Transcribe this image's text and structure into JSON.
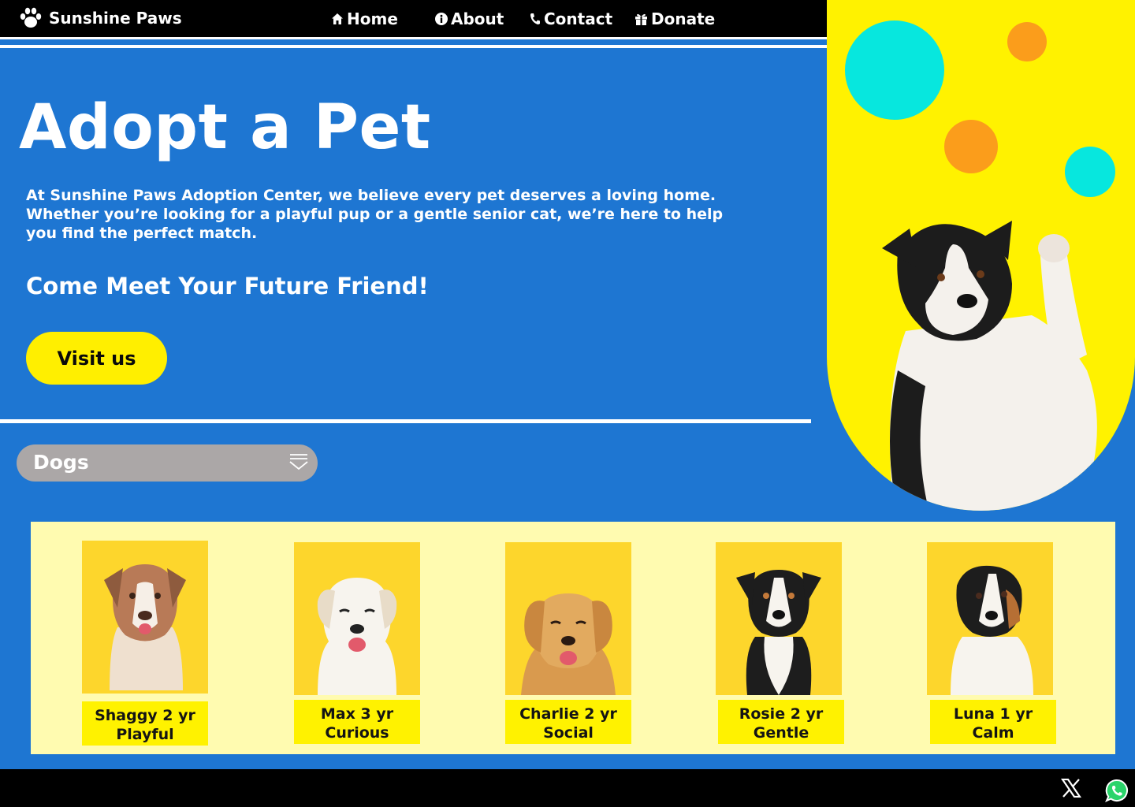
{
  "brand": {
    "name": "Sunshine Paws",
    "icon": "paw-icon"
  },
  "nav": {
    "home": "Home",
    "about": "About",
    "contact": "Contact",
    "donate": "Donate"
  },
  "hero": {
    "title": "Adopt a Pet",
    "description": "At Sunshine Paws Adoption Center, we believe every pet deserves a loving home. Whether you’re looking for a playful pup or a gentle senior cat, we’re here to help you find the perfect match.",
    "subtitle": "Come Meet Your Future Friend!",
    "cta": "Visit us"
  },
  "filter": {
    "selected": "Dogs",
    "icon": "chevron-down-icon"
  },
  "pets": [
    {
      "line1": "Shaggy  2 yr",
      "line2": "Playful",
      "coat": "merle"
    },
    {
      "line1": "Max  3 yr",
      "line2": "Curious",
      "coat": "white"
    },
    {
      "line1": "Charlie  2 yr",
      "line2": "Social",
      "coat": "golden"
    },
    {
      "line1": "Rosie  2 yr",
      "line2": "Gentle",
      "coat": "tricolor"
    },
    {
      "line1": "Luna  1 yr",
      "line2": "Calm",
      "coat": "tricolor"
    }
  ],
  "colors": {
    "background": "#1e76d2",
    "accent_yellow": "#ffef00",
    "panel_yellow": "#fff200",
    "turquoise": "#07e7de",
    "orange": "#fb9d1b",
    "gallery_bg": "#fffbb0",
    "photo_bg": "#fdd62c"
  },
  "footer": {
    "icons": [
      "x-logo-icon",
      "whatsapp-icon"
    ]
  }
}
